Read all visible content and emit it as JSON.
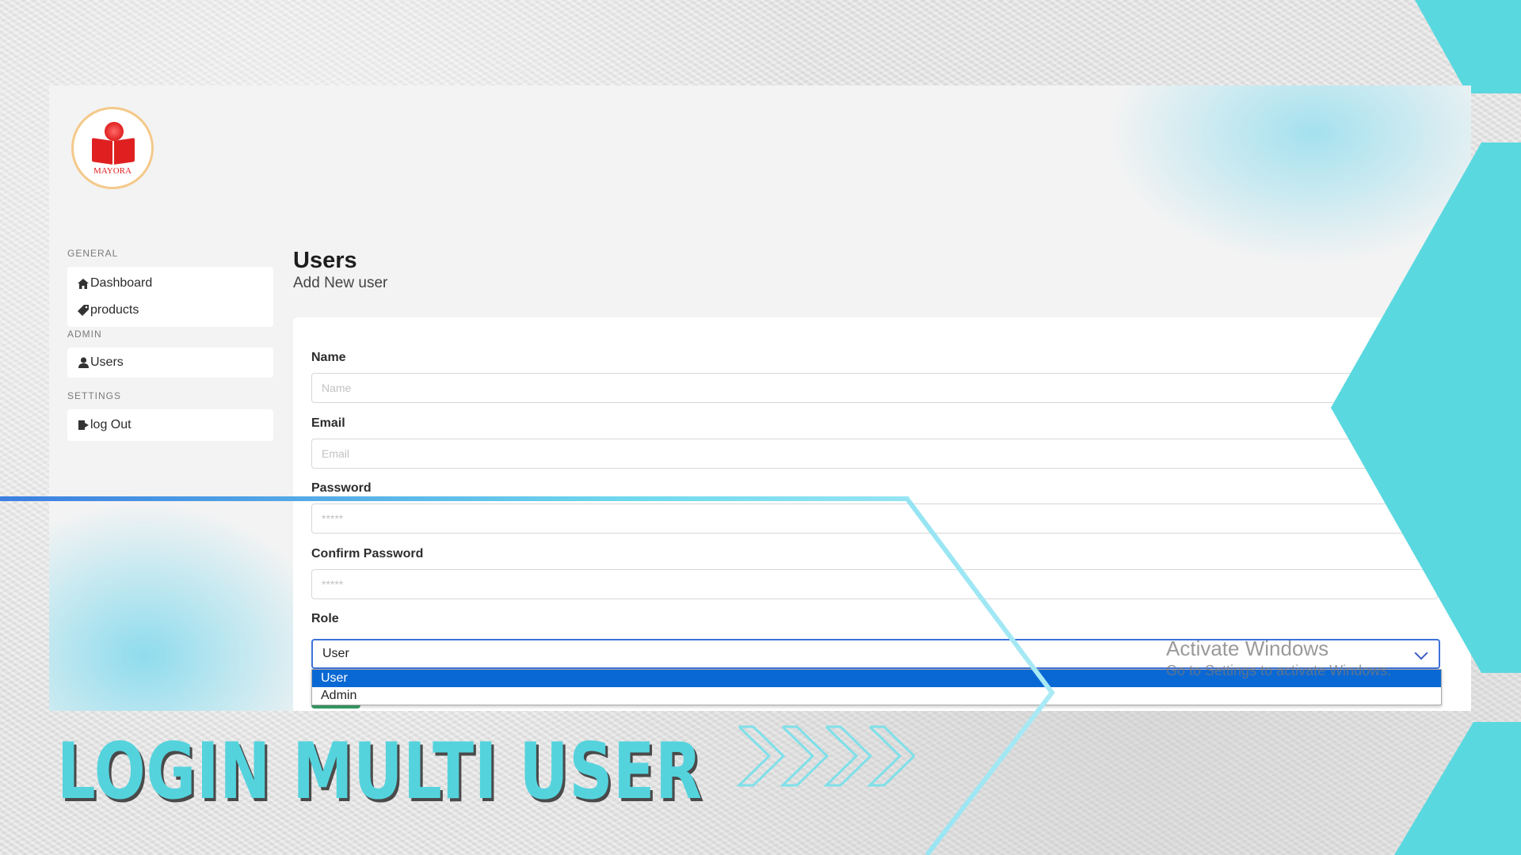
{
  "logo": {
    "text": "MAYORA"
  },
  "sidebar": {
    "sections": [
      {
        "label": "GENERAL",
        "items": [
          {
            "label": "Dashboard",
            "icon": "home-icon"
          },
          {
            "label": "products",
            "icon": "tag-icon"
          }
        ]
      },
      {
        "label": "ADMIN",
        "items": [
          {
            "label": "Users",
            "icon": "user-icon"
          }
        ]
      },
      {
        "label": "SETTINGS",
        "items": [
          {
            "label": "log Out",
            "icon": "logout-icon"
          }
        ]
      }
    ]
  },
  "main": {
    "title": "Users",
    "subtitle": "Add New user",
    "form": {
      "name": {
        "label": "Name",
        "placeholder": "Name"
      },
      "email": {
        "label": "Email",
        "placeholder": "Email"
      },
      "password": {
        "label": "Password",
        "placeholder": "*****"
      },
      "confirm_password": {
        "label": "Confirm Password",
        "placeholder": "*****"
      },
      "role": {
        "label": "Role",
        "value": "User",
        "options": [
          "User",
          "Admin"
        ],
        "highlighted": "User"
      }
    }
  },
  "watermark": {
    "line1": "Activate Windows",
    "line2": "Go to Settings to activate Windows."
  },
  "banner": {
    "headline": "LOGIN MULTI USER"
  },
  "colors": {
    "accent_cyan": "#5ad8df",
    "select_blue": "#0a68d4",
    "logo_red": "#e02020"
  }
}
